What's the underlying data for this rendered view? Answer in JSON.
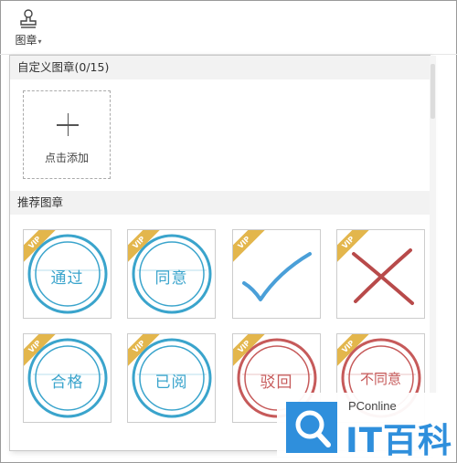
{
  "toolbar": {
    "stamp_label": "图章",
    "caret": "▾"
  },
  "panel": {
    "custom_section_title": "自定义图章(0/15)",
    "add_label": "点击添加",
    "recommended_section_title": "推荐图章"
  },
  "stamps": [
    {
      "text": "通过",
      "vip": "VIP",
      "color": "#3aa4cc"
    },
    {
      "text": "同意",
      "vip": "VIP",
      "color": "#3aa4cc"
    },
    {
      "text": "",
      "vip": "VIP",
      "icon": "checkmark-icon",
      "color": "#4a9fd8"
    },
    {
      "text": "",
      "vip": "VIP",
      "icon": "cross-icon",
      "color": "#b84a4a"
    },
    {
      "text": "合格",
      "vip": "VIP",
      "color": "#3aa4cc"
    },
    {
      "text": "已阅",
      "vip": "VIP",
      "color": "#3aa4cc"
    },
    {
      "text": "驳回",
      "vip": "VIP",
      "color": "#c65a5a"
    },
    {
      "text": "不同意",
      "vip": "VIP",
      "color": "#c65a5a"
    }
  ],
  "watermark": {
    "brand": "PConline",
    "name": "IT百科",
    "color": "#2f8fdc"
  }
}
